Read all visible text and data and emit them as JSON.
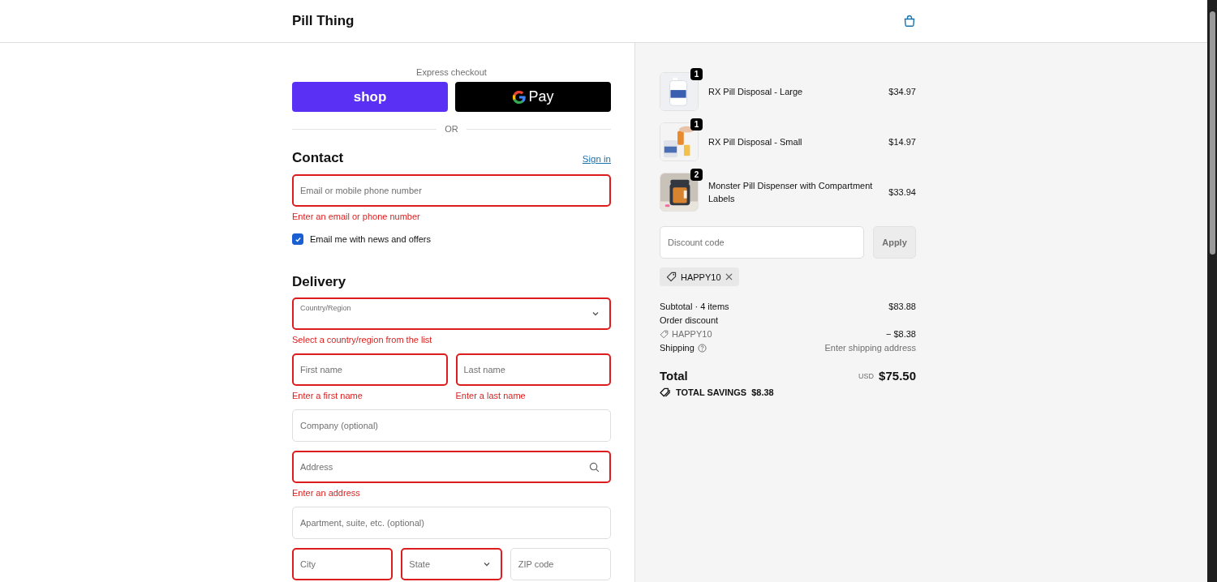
{
  "header": {
    "brand": "Pill Thing"
  },
  "express": {
    "label": "Express checkout",
    "buttons": [
      {
        "kind": "shop",
        "label": "shop"
      },
      {
        "kind": "gpay",
        "label": "Pay"
      }
    ],
    "divider": "OR"
  },
  "contact": {
    "title": "Contact",
    "sign_in": "Sign in",
    "email": {
      "kind": "text",
      "placeholder": "Email or mobile phone number",
      "error": true,
      "message": "Enter an email or phone number"
    },
    "newsletter": {
      "label": "Email me with news and offers",
      "checked": true
    }
  },
  "delivery": {
    "title": "Delivery",
    "rows": [
      [
        {
          "kind": "select",
          "placeholder": "Country/Region",
          "error": true,
          "message": "Select a country/region from the list"
        }
      ],
      [
        {
          "kind": "text",
          "placeholder": "First name",
          "error": true,
          "message": "Enter a first name"
        },
        {
          "kind": "text",
          "placeholder": "Last name",
          "error": true,
          "message": "Enter a last name"
        }
      ],
      [
        {
          "kind": "text",
          "placeholder": "Company (optional)",
          "error": false
        }
      ],
      [
        {
          "kind": "search",
          "placeholder": "Address",
          "error": true,
          "message": "Enter an address"
        }
      ],
      [
        {
          "kind": "text",
          "placeholder": "Apartment, suite, etc. (optional)",
          "error": false
        }
      ],
      [
        {
          "kind": "text",
          "placeholder": "City",
          "error": true
        },
        {
          "kind": "dropdown",
          "placeholder": "State",
          "error": true
        },
        {
          "kind": "text",
          "placeholder": "ZIP code",
          "error": false
        }
      ]
    ]
  },
  "summary": {
    "items": [
      {
        "name": "RX Pill Disposal - Large",
        "price": "$34.97",
        "quantity": "1"
      },
      {
        "name": "RX Pill Disposal - Small",
        "price": "$14.97",
        "quantity": "1"
      },
      {
        "name": "Monster Pill Dispenser with Compartment Labels",
        "price": "$33.94",
        "quantity": "2"
      }
    ],
    "discount": {
      "placeholder": "Discount code",
      "button": "Apply",
      "applied": "HAPPY10"
    },
    "subtotal": {
      "label": "Subtotal · 4 items",
      "value": "$83.88"
    },
    "order_discount": {
      "label": "Order discount",
      "code": "HAPPY10",
      "value": "− $8.38"
    },
    "shipping": {
      "label": "Shipping",
      "value": "Enter shipping address"
    },
    "total": {
      "label": "Total",
      "currency": "USD",
      "value": "$75.50"
    },
    "savings": {
      "label": "TOTAL SAVINGS",
      "value": "$8.38"
    }
  }
}
